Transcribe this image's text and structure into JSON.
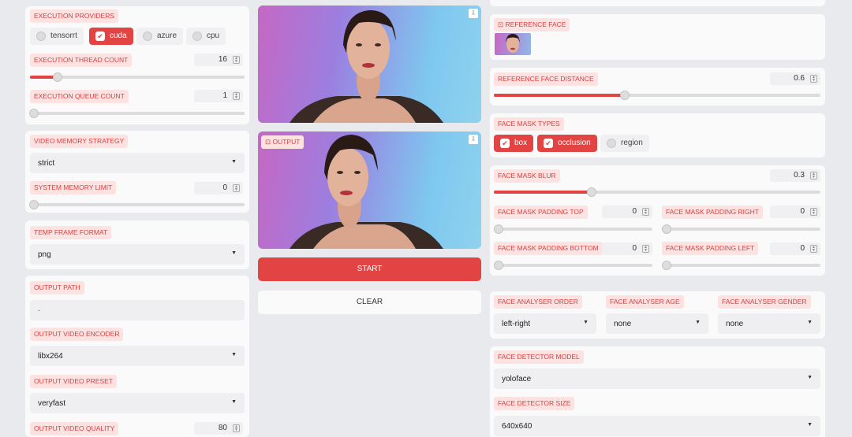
{
  "left": {
    "execution_providers": {
      "label": "EXECUTION PROVIDERS",
      "options": [
        {
          "label": "tensorrt",
          "checked": false
        },
        {
          "label": "cuda",
          "checked": true
        },
        {
          "label": "azure",
          "checked": false
        },
        {
          "label": "cpu",
          "checked": false
        }
      ]
    },
    "thread_count": {
      "label": "EXECUTION THREAD COUNT",
      "value": "16",
      "level": 0.12
    },
    "queue_count": {
      "label": "EXECUTION QUEUE COUNT",
      "value": "1",
      "level": 0.0
    },
    "memory_strategy": {
      "label": "VIDEO MEMORY STRATEGY",
      "value": "strict"
    },
    "memory_limit": {
      "label": "SYSTEM MEMORY LIMIT",
      "value": "0",
      "level": 0.0
    },
    "temp_frame_format": {
      "label": "TEMP FRAME FORMAT",
      "value": "png"
    },
    "output_path": {
      "label": "OUTPUT PATH",
      "value": "."
    },
    "video_encoder": {
      "label": "OUTPUT VIDEO ENCODER",
      "value": "libx264"
    },
    "video_preset": {
      "label": "OUTPUT VIDEO PRESET",
      "value": "veryfast"
    },
    "video_quality": {
      "label": "OUTPUT VIDEO QUALITY",
      "value": "80"
    }
  },
  "center": {
    "output_label": "OUTPUT",
    "start_label": "START",
    "clear_label": "CLEAR"
  },
  "right": {
    "reference_face": {
      "label": "REFERENCE FACE"
    },
    "reference_distance": {
      "label": "REFERENCE FACE DISTANCE",
      "value": "0.6",
      "level": 0.4
    },
    "mask_types": {
      "label": "FACE MASK TYPES",
      "options": [
        {
          "label": "box",
          "checked": true
        },
        {
          "label": "occlusion",
          "checked": true
        },
        {
          "label": "region",
          "checked": false
        }
      ]
    },
    "mask_blur": {
      "label": "FACE MASK BLUR",
      "value": "0.3",
      "level": 0.3
    },
    "padding_top": {
      "label": "FACE MASK PADDING TOP",
      "value": "0"
    },
    "padding_right": {
      "label": "FACE MASK PADDING RIGHT",
      "value": "0"
    },
    "padding_bottom": {
      "label": "FACE MASK PADDING BOTTOM",
      "value": "0"
    },
    "padding_left": {
      "label": "FACE MASK PADDING LEFT",
      "value": "0"
    },
    "analyser_order": {
      "label": "FACE ANALYSER ORDER",
      "value": "left-right"
    },
    "analyser_age": {
      "label": "FACE ANALYSER AGE",
      "value": "none"
    },
    "analyser_gender": {
      "label": "FACE ANALYSER GENDER",
      "value": "none"
    },
    "detector_model": {
      "label": "FACE DETECTOR MODEL",
      "value": "yoloface"
    },
    "detector_size": {
      "label": "FACE DETECTOR SIZE",
      "value": "640x640"
    }
  },
  "colors": {
    "accent": "#e24444",
    "label_bg": "#fde2e2",
    "label_text": "#d94040"
  }
}
